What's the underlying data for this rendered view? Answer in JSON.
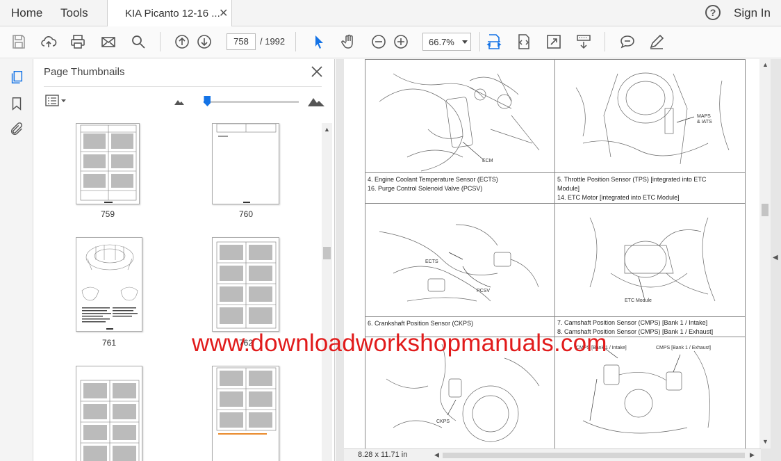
{
  "menubar": {
    "home": "Home",
    "tools": "Tools",
    "doc_tab_title": "KIA Picanto  12-16 ...",
    "help_glyph": "?",
    "sign_in": "Sign In"
  },
  "toolbar": {
    "page_current": "758",
    "page_total": "/  1992",
    "zoom": "66.7%",
    "icons": [
      "save-icon",
      "upload-cloud-icon",
      "print-icon",
      "email-icon",
      "search-icon",
      "page-up-icon",
      "page-down-icon",
      "select-cursor-icon",
      "hand-tool-icon",
      "zoom-out-icon",
      "zoom-in-icon",
      "fit-page-icon",
      "rotate-page-icon",
      "full-screen-icon",
      "scroll-mode-icon",
      "comment-icon",
      "sign-icon"
    ],
    "accent_color": "#1473e6"
  },
  "panel": {
    "title": "Page Thumbnails",
    "zoom_slider_fraction": 0.04,
    "thumbnails": [
      {
        "label": "759"
      },
      {
        "label": "760"
      },
      {
        "label": "761"
      },
      {
        "label": "762"
      },
      {
        "label": ""
      },
      {
        "label": ""
      }
    ]
  },
  "document": {
    "captions": [
      {
        "lines": [
          "4. Engine Coolant Temperature Sensor (ECTS)",
          "16. Purge Control Solenoid Valve (PCSV)"
        ]
      },
      {
        "lines": [
          "5. Throttle Position Sensor (TPS) [integrated into ETC",
          "Module]",
          "14. ETC Motor [integrated into ETC Module]"
        ]
      },
      {
        "lines": [
          "6. Crankshaft Position Sensor (CKPS)"
        ]
      },
      {
        "lines": [
          "7. Camshaft Position Sensor (CMPS) [Bank 1 / Intake]",
          "8. Camshaft Position Sensor (CMPS) [Bank 1 / Exhaust]"
        ]
      }
    ],
    "diagram_labels": {
      "ecm": "ECM",
      "maps_line1": "MAPS",
      "maps_line2": "& IATS",
      "ects": "ECTS",
      "pcsv": "PCSV",
      "etc": "ETC Module",
      "ckps": "CKPS",
      "cmps_intake": "CMPS [Bank 1 / Intake]",
      "cmps_exhaust": "CMPS [Bank 1 / Exhaust]"
    },
    "watermark": "www.downloadworkshopmanuals.com",
    "watermark_color": "#e11b1b"
  },
  "status": {
    "page_size": "8.28 x 11.71 in"
  }
}
